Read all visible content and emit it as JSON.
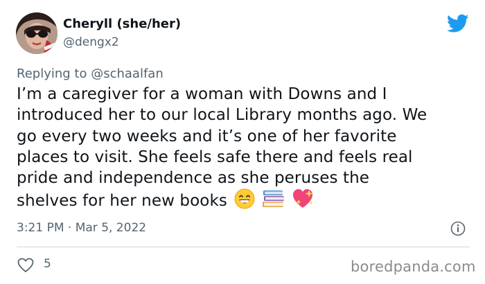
{
  "author": {
    "display_name": "Cheryll (she/her)",
    "handle": "@dengx2"
  },
  "reply": {
    "prefix": "Replying to",
    "to_handle": "@schaalfan"
  },
  "tweet": {
    "lines": [
      "I’m a caregiver for a woman with Downs and I",
      "introduced her to our local Library months ago. We",
      "go every two weeks and it’s one of her favorite",
      "places to visit. She feels safe there and feels real",
      "pride and independence as she peruses the",
      "shelves for her new books"
    ],
    "emojis": [
      "grinning-face-emoji",
      "books-emoji",
      "sparkling-heart-emoji"
    ]
  },
  "meta": {
    "timestamp": "3:21 PM · Mar 5, 2022"
  },
  "actions": {
    "like_count": "5"
  },
  "watermark": "boredpanda.com",
  "colors": {
    "text": "#0f1419",
    "secondary": "#536471",
    "twitter_blue": "#1d9bf0",
    "divider": "#cfd9de"
  }
}
